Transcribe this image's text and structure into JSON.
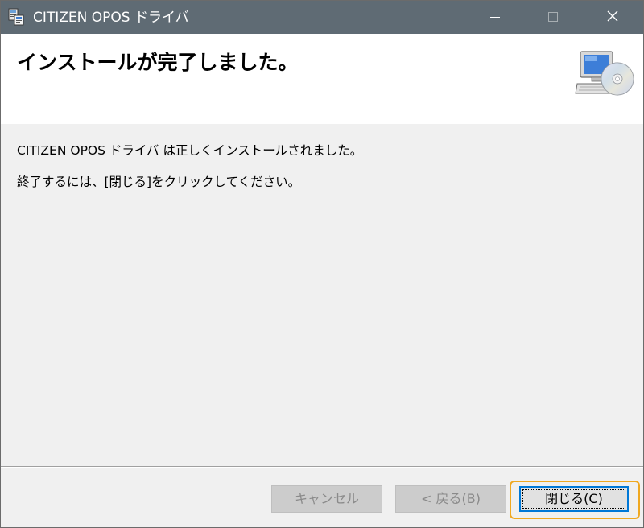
{
  "window": {
    "title": "CITIZEN OPOS ドライバ",
    "controls": {
      "minimize": "minimize-icon",
      "maximize": "maximize-icon",
      "close": "close-icon"
    }
  },
  "header": {
    "title": "インストールが完了しました。",
    "graphic": "computer-cd-icon"
  },
  "body": {
    "line1": "CITIZEN OPOS ドライバ は正しくインストールされました。",
    "line2": "終了するには、[閉じる]をクリックしてください。"
  },
  "footer": {
    "cancel_label": "キャンセル",
    "back_label": "< 戻る(B)",
    "close_label": "閉じる(C)"
  },
  "colors": {
    "titlebar": "#5f6b74",
    "focus_highlight": "#f0a820",
    "button_focus_border": "#0078d7"
  }
}
